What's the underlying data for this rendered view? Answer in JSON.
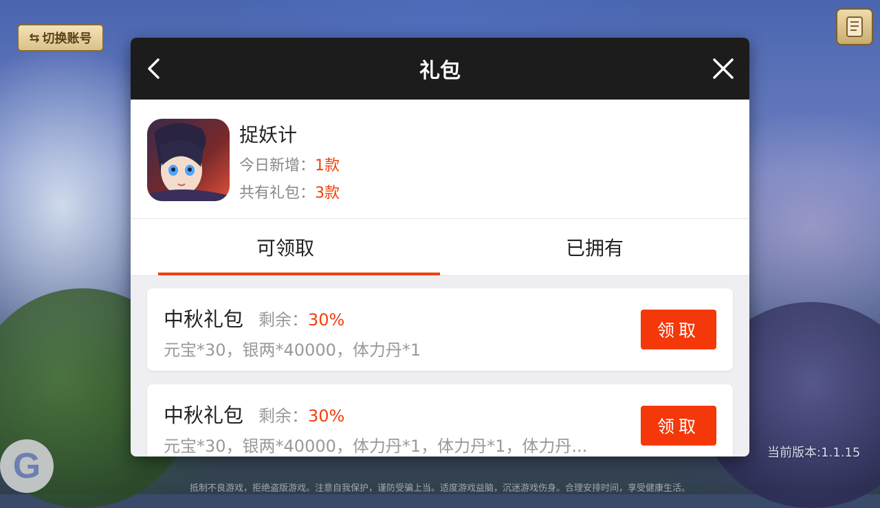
{
  "background": {
    "switch_account_label": "切换账号",
    "version_text": "当前版本:1.1.15",
    "footer_notice": "抵制不良游戏，拒绝盗版游戏。注意自我保护，谨防受骗上当。适度游戏益脑，沉迷游戏伤身。合理安排时间，享受健康生活。",
    "badge_letter": "G"
  },
  "dialog": {
    "title": "礼包"
  },
  "game": {
    "name": "捉妖计",
    "today_label": "今日新增：",
    "today_value": "1款",
    "total_label": "共有礼包：",
    "total_value": "3款"
  },
  "tabs": [
    {
      "label": "可领取",
      "active": true
    },
    {
      "label": "已拥有",
      "active": false
    }
  ],
  "gifts": [
    {
      "name": "中秋礼包",
      "remain_label": "剩余：",
      "remain_value": "30%",
      "content": "元宝*30，银两*40000，体力丹*1",
      "button_label": "领取"
    },
    {
      "name": "中秋礼包",
      "remain_label": "剩余：",
      "remain_value": "30%",
      "content": "元宝*30，银两*40000，体力丹*1，体力丹*1，体力丹...",
      "button_label": "领取"
    }
  ],
  "colors": {
    "accent": "#f0400c",
    "header_bg": "#1d1c1d"
  },
  "icons": {
    "back": "chevron-left-icon",
    "close": "close-icon",
    "notice": "scroll-icon",
    "switch": "swap-arrows-icon"
  }
}
